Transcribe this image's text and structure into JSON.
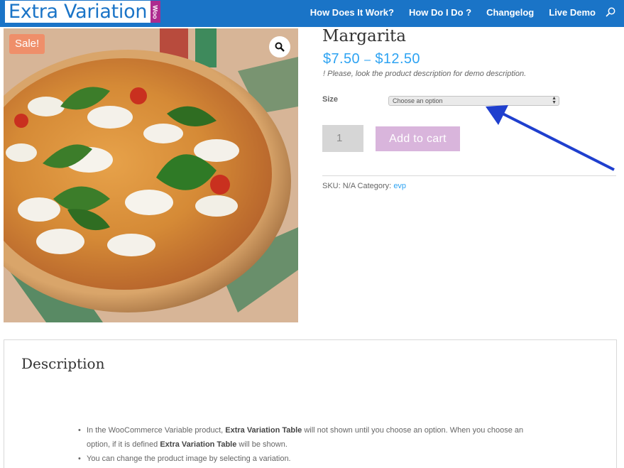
{
  "header": {
    "logo_text": "Extra Variation",
    "logo_badge": "Woo",
    "nav": [
      {
        "label": "How Does It Work?"
      },
      {
        "label": "How Do I Do ?"
      },
      {
        "label": "Changelog"
      },
      {
        "label": "Live Demo"
      }
    ],
    "search_icon": "search-icon"
  },
  "product": {
    "sale_badge": "Sale!",
    "zoom_icon": "magnifier-icon",
    "title": "Margarita",
    "price_low": "$7.50",
    "price_sep": "–",
    "price_high": "$12.50",
    "note": "! Please, look the product description for demo description.",
    "size_label": "Size",
    "size_selected": "Choose an option",
    "quantity": "1",
    "add_to_cart": "Add to cart",
    "meta_sku_label": "SKU:",
    "meta_sku_value": "N/A",
    "meta_category_label": "Category:",
    "meta_category_value": "evp"
  },
  "description": {
    "title": "Description",
    "items": [
      {
        "p1": "In the WooCommerce Variable product, ",
        "b1": "Extra Variation Table",
        "p2": " will not shown until you choose an option. When you choose an option, if it is defined ",
        "b2": "Extra Variation Table",
        "p3": " will be shown."
      },
      {
        "p1": "You can change the product image by selecting a variation."
      }
    ]
  },
  "colors": {
    "header_bg": "#1a74c7",
    "link": "#2ea3f2",
    "sale": "#ef8f6a",
    "button": "#d9b5dc",
    "annotation_arrow": "#1f3fce"
  }
}
